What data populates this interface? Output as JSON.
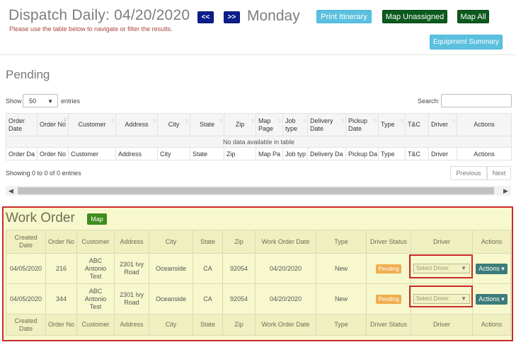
{
  "header": {
    "title_prefix": "Dispatch Daily: ",
    "date": "04/20/2020",
    "subtitle": "Please use the table below to navigate or filter the results.",
    "prev_label": "<<",
    "next_label": ">>",
    "weekday": "Monday",
    "print_label": "Print Itinerary",
    "map_unassigned_label": "Map Unassigned",
    "map_all_label": "Map All",
    "equipment_label": "Equipment Summary"
  },
  "pending": {
    "title": "Pending",
    "show_label": "Show",
    "entries_label": "entries",
    "page_size": "50",
    "search_label": "Search:",
    "columns": [
      "Order Date",
      "Order No",
      "Customer",
      "Address",
      "City",
      "State",
      "Zip",
      "Map Page",
      "Job type",
      "Delivery Date",
      "Pickup Date",
      "Type",
      "T&C",
      "Driver",
      "Actions"
    ],
    "footer_columns": [
      "Order Da",
      "Order No",
      "Customer",
      "Address",
      "City",
      "State",
      "Zip",
      "Map Pa",
      "Job typ",
      "Delivery Da",
      "Pickup Da",
      "Type",
      "T&C",
      "Driver",
      "Actions"
    ],
    "empty_text": "No data available in table",
    "info": "Showing 0 to 0 of 0 entries",
    "previous_label": "Previous",
    "next_label": "Next"
  },
  "work_order": {
    "title": "Work Order",
    "map_label": "Map",
    "columns": [
      "Created Date",
      "Order No",
      "Customer",
      "Address",
      "City",
      "State",
      "Zip",
      "Work Order Date",
      "Type",
      "Driver Status",
      "Driver",
      "Actions"
    ],
    "rows": [
      {
        "created": "04/05/2020",
        "order_no": "216",
        "customer": "ABC Antonio Test",
        "address": "2301 Ivy Road",
        "city": "Oceanside",
        "state": "CA",
        "zip": "92054",
        "wo_date": "04/20/2020",
        "type": "New",
        "status": "Pending",
        "driver": "Select Driver",
        "actions": "Actions"
      },
      {
        "created": "04/05/2020",
        "order_no": "344",
        "customer": "ABC Antonio Test",
        "address": "2301 Ivy Road",
        "city": "Oceanside",
        "state": "CA",
        "zip": "92054",
        "wo_date": "04/20/2020",
        "type": "New",
        "status": "Pending",
        "driver": "Select Driver",
        "actions": "Actions"
      }
    ]
  },
  "colors": {
    "accent_navy": "#0b1e8c",
    "info_blue": "#5bc0de",
    "dark_green": "#0b5a1c",
    "highlight_red": "#cc2a2a",
    "panel_yellow": "#f7f8cd",
    "pending_orange": "#f0ad4e"
  }
}
